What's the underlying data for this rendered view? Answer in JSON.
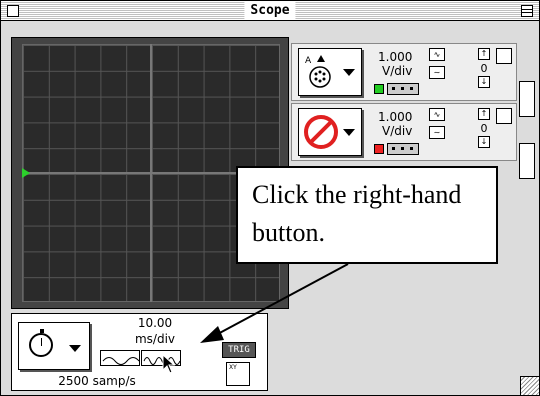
{
  "window": {
    "title": "Scope"
  },
  "channels": [
    {
      "scale_value": "1.000",
      "scale_unit": "V/div",
      "offset": "0",
      "color": "#22cc22",
      "button_icon": "analog-probe-icon"
    },
    {
      "scale_value": "1.000",
      "scale_unit": "V/div",
      "offset": "0",
      "color": "#ee2222",
      "button_icon": "disabled-icon"
    }
  ],
  "timebase": {
    "value": "10.00",
    "unit": "ms/div",
    "sample_rate": "2500 samp/s"
  },
  "buttons": {
    "trig": "TRIG",
    "xy": "XY"
  },
  "annotation": {
    "text": "Click the right-hand button."
  },
  "colors": {
    "trace_green": "#22cc22",
    "channel_red": "#ee2222"
  }
}
